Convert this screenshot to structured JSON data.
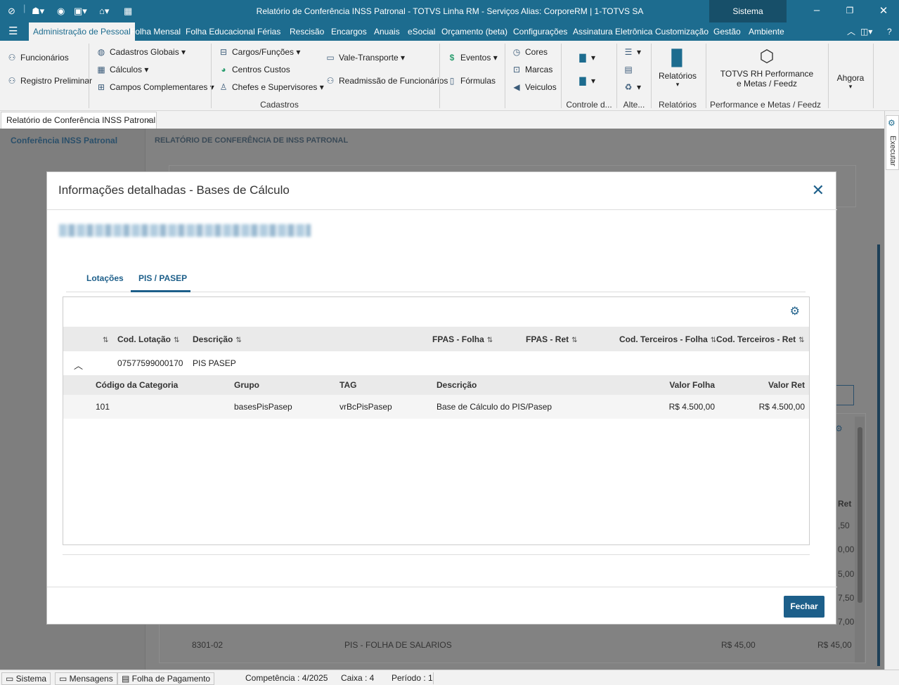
{
  "window": {
    "title": "Relatório de Conferência INSS Patronal - TOTVS Linha RM - Serviços  Alias: CorporeRM | 1-TOTVS SA",
    "sistema_label": "Sistema"
  },
  "menu": {
    "items": [
      "Administração de Pessoal",
      "Folha Mensal",
      "Folha Educacional",
      "Férias",
      "Rescisão",
      "Encargos",
      "Anuais",
      "eSocial",
      "Orçamento (beta)",
      "Configurações",
      "Assinatura Eletrônica",
      "Customização",
      "Gestão",
      "Ambiente"
    ]
  },
  "ribbon": {
    "funcionarios": "Funcionários",
    "registro_preliminar": "Registro Preliminar",
    "cadastros_globais": "Cadastros Globais",
    "calculos": "Cálculos",
    "campos_complementares": "Campos Complementares",
    "cargos_funcoes": "Cargos/Funções",
    "centros_custos": "Centros Custos",
    "chefes_supervisores": "Chefes e Supervisores",
    "vale_transporte": "Vale-Transporte",
    "readmissao": "Readmissão de Funcionários",
    "eventos": "Eventos",
    "formulas": "Fórmulas",
    "cores": "Cores",
    "marcas": "Marcas",
    "veiculos": "Veiculos",
    "relatorios": "Relatórios",
    "totvs_rh_1": "TOTVS RH Performance",
    "totvs_rh_2": "e Metas / Feedz",
    "ahgora": "Ahgora",
    "group_cadastros": "Cadastros",
    "group_controle": "Controle d...",
    "group_alte": "Alte...",
    "group_relatorios": "Relatórios",
    "group_performance": "Performance e Metas / Feedz"
  },
  "doc_tab": {
    "label": "Relatório de Conferência INSS Patronal"
  },
  "background": {
    "sidebar_title": "Conferência INSS Patronal",
    "page_title": "RELATÓRIO DE CONFERÊNCIA DE INSS PATRONAL",
    "col_ret": "Ret",
    "values": [
      ",50",
      "0,00",
      "5,00",
      "7,50",
      "7,00"
    ],
    "last_row": {
      "code": "8301-02",
      "desc": "PIS - FOLHA DE SALARIOS",
      "v1": "R$ 45,00",
      "v2": "R$ 45,00"
    },
    "executar": "Executar"
  },
  "modal": {
    "title": "Informações detalhadas - Bases de Cálculo",
    "tabs": [
      "Lotações",
      "PIS / PASEP"
    ],
    "grid_headers": [
      "Cod. Lotação",
      "Descrição",
      "FPAS - Folha",
      "FPAS - Ret",
      "Cod. Terceiros - Folha",
      "Cod. Terceiros - Ret"
    ],
    "group_row": {
      "cod": "07577599000170",
      "desc": "PIS PASEP"
    },
    "sub_headers": [
      "Código da Categoria",
      "Grupo",
      "TAG",
      "Descrição",
      "Valor Folha",
      "Valor Ret"
    ],
    "sub_row": {
      "categoria": "101",
      "grupo": "basesPisPasep",
      "tag": "vrBcPisPasep",
      "descricao": "Base de Cálculo do PIS/Pasep",
      "valor_folha": "R$ 4.500,00",
      "valor_ret": "R$ 4.500,00"
    },
    "close_button": "Fechar"
  },
  "status": {
    "sistema": "Sistema",
    "mensagens": "Mensagens",
    "folha": "Folha de Pagamento",
    "competencia": "Competência : 4/2025",
    "caixa": "Caixa : 4",
    "periodo": "Período : 1"
  },
  "colors": {
    "brand": "#1d6c8f",
    "accent": "#1d5f8a"
  }
}
